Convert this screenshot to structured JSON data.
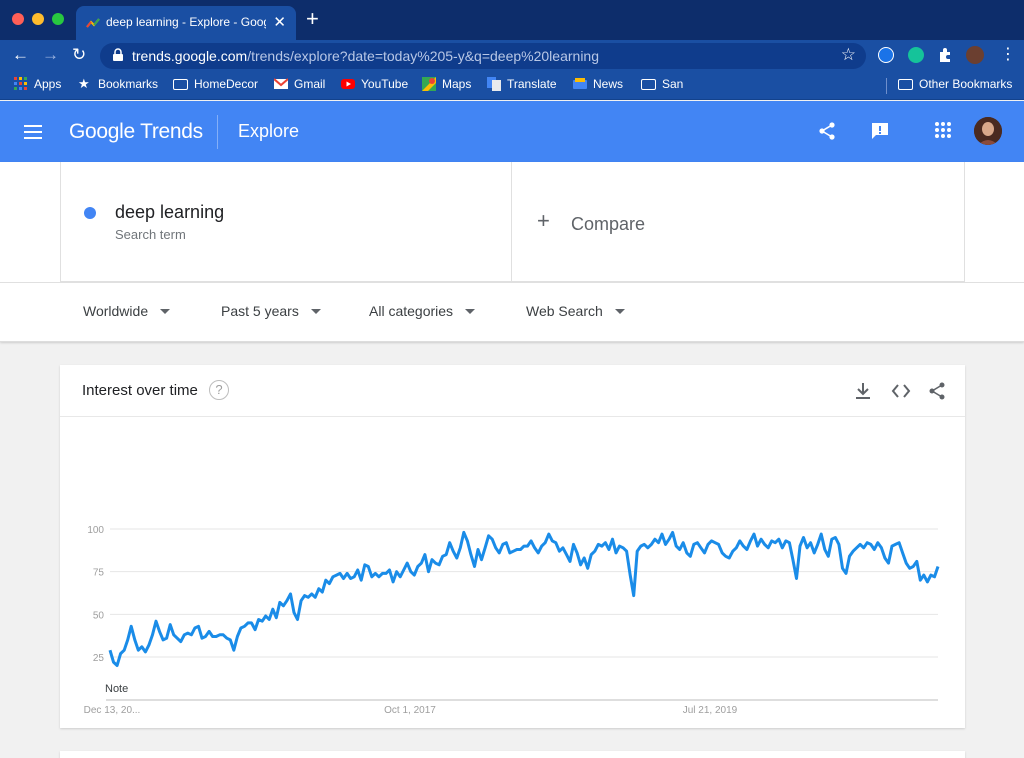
{
  "browser": {
    "tab_title": "deep learning - Explore - Goog",
    "url_host": "trends.google.com",
    "url_path": "/trends/explore?date=today%205-y&q=deep%20learning",
    "bookmarks": [
      {
        "label": "Apps",
        "icon": "apps-grid-icon"
      },
      {
        "label": "Bookmarks",
        "icon": "star-icon"
      },
      {
        "label": "HomeDecor",
        "icon": "folder-icon"
      },
      {
        "label": "Gmail",
        "icon": "gmail-icon"
      },
      {
        "label": "YouTube",
        "icon": "youtube-icon"
      },
      {
        "label": "Maps",
        "icon": "maps-icon"
      },
      {
        "label": "Translate",
        "icon": "translate-icon"
      },
      {
        "label": "News",
        "icon": "news-icon"
      },
      {
        "label": "San",
        "icon": "folder-icon"
      }
    ],
    "other_bookmarks": "Other Bookmarks"
  },
  "header": {
    "logo_google": "Google",
    "logo_trends": "Trends",
    "section": "Explore"
  },
  "search": {
    "term": "deep learning",
    "term_sub": "Search term",
    "term_color": "#4285f4",
    "compare_label": "Compare"
  },
  "filters": [
    {
      "label": "Worldwide"
    },
    {
      "label": "Past 5 years"
    },
    {
      "label": "All categories"
    },
    {
      "label": "Web Search"
    }
  ],
  "card": {
    "title": "Interest over time",
    "help": "?"
  },
  "chart_data": {
    "type": "line",
    "title": "Interest over time",
    "ylim": [
      0,
      100
    ],
    "yticks": [
      25,
      50,
      75,
      100
    ],
    "x_tick_labels": [
      "Dec 13, 20...",
      "Oct 1, 2017",
      "Jul 21, 2019"
    ],
    "annotation": "Note",
    "grid": true,
    "series": [
      {
        "color": "#1a8ce8",
        "values": [
          29,
          22,
          20,
          27,
          29,
          35,
          43,
          35,
          29,
          31,
          28,
          32,
          38,
          46,
          40,
          35,
          36,
          44,
          38,
          36,
          34,
          38,
          39,
          38,
          42,
          43,
          36,
          37,
          40,
          37,
          37,
          38,
          38,
          36,
          35,
          29,
          37,
          42,
          43,
          45,
          45,
          41,
          47,
          46,
          49,
          47,
          53,
          48,
          57,
          55,
          58,
          62,
          51,
          47,
          58,
          61,
          60,
          62,
          60,
          65,
          63,
          70,
          68,
          72,
          73,
          74,
          71,
          74,
          71,
          72,
          76,
          70,
          79,
          78,
          72,
          74,
          72,
          74,
          74,
          76,
          69,
          75,
          72,
          76,
          80,
          75,
          73,
          78,
          80,
          85,
          75,
          82,
          80,
          79,
          84,
          85,
          92,
          87,
          83,
          89,
          98,
          93,
          85,
          78,
          88,
          82,
          89,
          96,
          94,
          89,
          86,
          91,
          92,
          86,
          87,
          88,
          88,
          90,
          90,
          93,
          89,
          86,
          90,
          92,
          97,
          93,
          92,
          87,
          89,
          85,
          81,
          91,
          86,
          79,
          83,
          77,
          85,
          87,
          91,
          90,
          92,
          88,
          94,
          86,
          90,
          89,
          87,
          73,
          61,
          87,
          90,
          91,
          89,
          91,
          94,
          92,
          97,
          91,
          94,
          98,
          90,
          88,
          92,
          86,
          84,
          91,
          92,
          89,
          86,
          91,
          93,
          92,
          91,
          86,
          84,
          83,
          87,
          89,
          93,
          90,
          88,
          93,
          97,
          90,
          94,
          91,
          89,
          93,
          92,
          94,
          89,
          93,
          92,
          82,
          71,
          90,
          95,
          89,
          92,
          86,
          91,
          97,
          88,
          84,
          94,
          95,
          91,
          77,
          74,
          84,
          87,
          89,
          91,
          89,
          92,
          91,
          88,
          92,
          89,
          83,
          80,
          90,
          91,
          92,
          86,
          80,
          77,
          78,
          81,
          70,
          73,
          69,
          73,
          72,
          78
        ]
      }
    ]
  }
}
